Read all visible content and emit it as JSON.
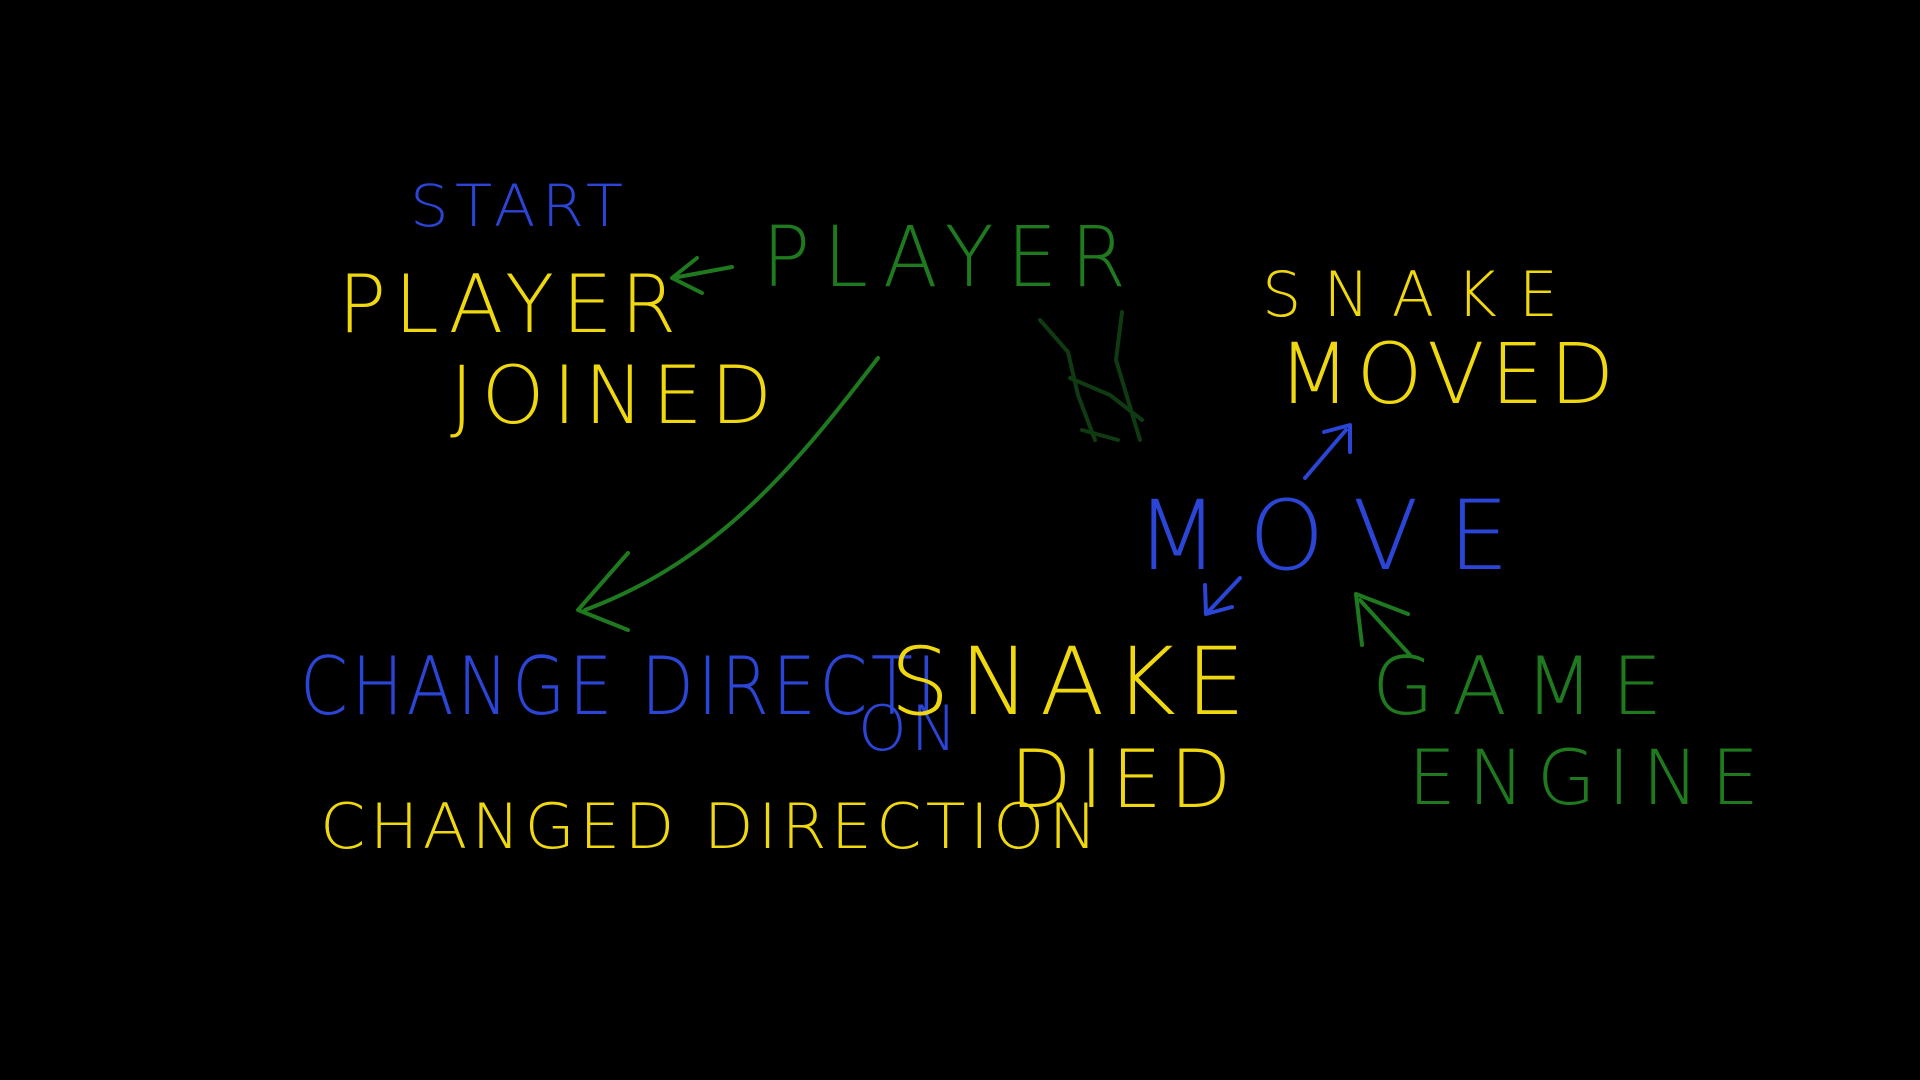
{
  "colors": {
    "background": "#000000",
    "blue": "#2b45d6",
    "yellow": "#f0d80f",
    "green": "#1f7a1f",
    "dark_green": "#0f3a12"
  },
  "labels": {
    "start": "START",
    "player": "PLAYER",
    "player_joined_line1": "PLAYER",
    "player_joined_line2": "JOINED",
    "snake_moved_line1": "SNAKE",
    "snake_moved_line2": "MOVED",
    "move": "MOVE",
    "change_direction": "CHANGE DIRECTI",
    "change_direction_suffix": "ON",
    "snake_died_line1": "SNAKE",
    "snake_died_line2": "DIED",
    "game_engine_line1": "GAME",
    "game_engine_line2": "ENGINE",
    "changed_direction": "CHANGED DIRECTION"
  }
}
